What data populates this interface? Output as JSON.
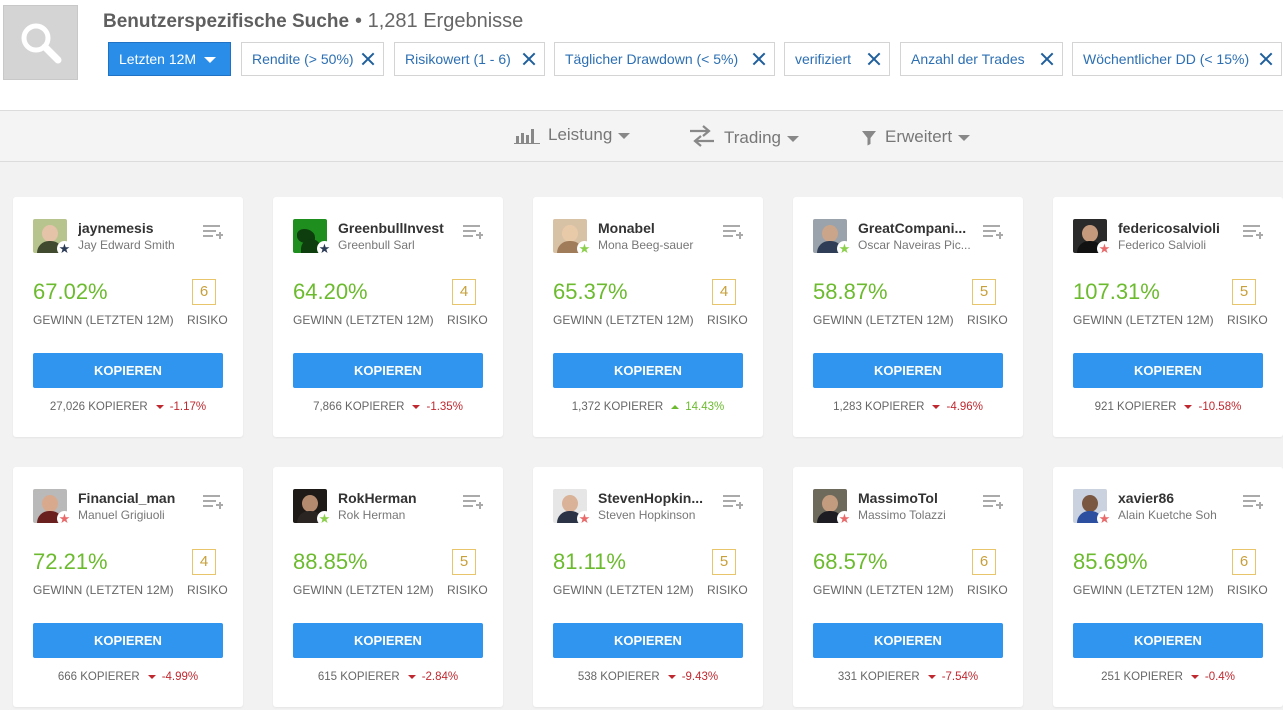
{
  "header": {
    "title": "Benutzerspezifische Suche",
    "result_count": "• 1,281 Ergebnisse",
    "period_button": "Letzten 12M",
    "filters": [
      "Rendite (> 50%)",
      "Risikowert (1 - 6)",
      "Täglicher Drawdown (< 5%)",
      "verifiziert",
      "Anzahl der Trades",
      "Wöchentlicher DD (< 15%)"
    ]
  },
  "toolbar": {
    "performance": "Leistung",
    "trading": "Trading",
    "advanced": "Erweitert"
  },
  "card_labels": {
    "gain_label": "GEWINN (LETZTEN 12M)",
    "risk_label": "RISIKO",
    "copy_button": "KOPIEREN",
    "copiers_suffix": "KOPIERER"
  },
  "traders": [
    {
      "username": "jaynemesis",
      "real_name": "Jay Edward Smith",
      "gain": "67.02%",
      "risk": "6",
      "copiers": "27,026",
      "change": "-1.17%",
      "direction": "down",
      "star_color": "#2b3a55"
    },
    {
      "username": "GreenbullInvest",
      "real_name": "Greenbull Sarl",
      "gain": "64.20%",
      "risk": "4",
      "copiers": "7,866",
      "change": "-1.35%",
      "direction": "down",
      "star_color": "#2b3a55"
    },
    {
      "username": "Monabel",
      "real_name": "Mona Beeg-sauer",
      "gain": "65.37%",
      "risk": "4",
      "copiers": "1,372",
      "change": "14.43%",
      "direction": "up",
      "star_color": "#8ccf4d"
    },
    {
      "username": "GreatCompani...",
      "real_name": "Oscar Naveiras Pic...",
      "gain": "58.87%",
      "risk": "5",
      "copiers": "1,283",
      "change": "-4.96%",
      "direction": "down",
      "star_color": "#8ccf4d"
    },
    {
      "username": "federicosalvioli",
      "real_name": "Federico Salvioli",
      "gain": "107.31%",
      "risk": "5",
      "copiers": "921",
      "change": "-10.58%",
      "direction": "down",
      "star_color": "#e86a6a"
    },
    {
      "username": "Financial_man",
      "real_name": "Manuel Grigiuoli",
      "gain": "72.21%",
      "risk": "4",
      "copiers": "666",
      "change": "-4.99%",
      "direction": "down",
      "star_color": "#e86a6a"
    },
    {
      "username": "RokHerman",
      "real_name": "Rok Herman",
      "gain": "88.85%",
      "risk": "5",
      "copiers": "615",
      "change": "-2.84%",
      "direction": "down",
      "star_color": "#8ccf4d"
    },
    {
      "username": "StevenHopkin...",
      "real_name": "Steven Hopkinson",
      "gain": "81.11%",
      "risk": "5",
      "copiers": "538",
      "change": "-9.43%",
      "direction": "down",
      "star_color": "#e86a6a"
    },
    {
      "username": "MassimoTol",
      "real_name": "Massimo Tolazzi",
      "gain": "68.57%",
      "risk": "6",
      "copiers": "331",
      "change": "-7.54%",
      "direction": "down",
      "star_color": "#e86a6a"
    },
    {
      "username": "xavier86",
      "real_name": "Alain Kuetche Soh",
      "gain": "85.69%",
      "risk": "6",
      "copiers": "251",
      "change": "-0.4%",
      "direction": "down",
      "star_color": "#e86a6a"
    }
  ]
}
